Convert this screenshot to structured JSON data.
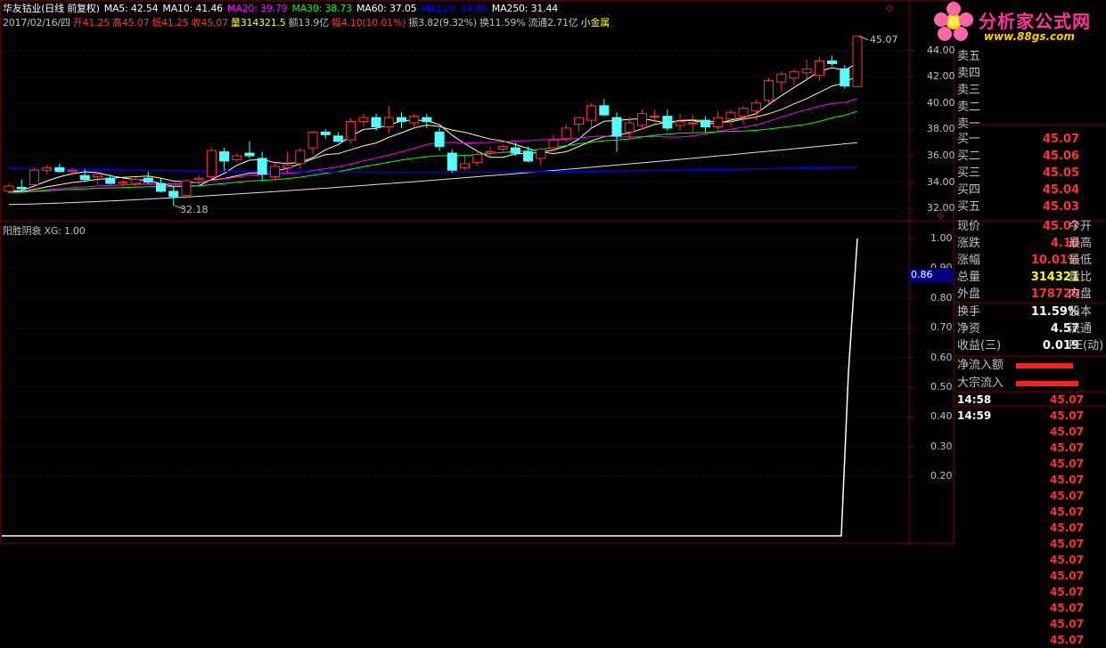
{
  "header": {
    "stock": "华友钴业(日线 前复权)",
    "ma": [
      {
        "label": "MA5: 42.54",
        "color": "#ffffff"
      },
      {
        "label": "MA10: 41.46",
        "color": "#ffffff"
      },
      {
        "label": "MA20: 39.79",
        "color": "#ff00ff"
      },
      {
        "label": "MA30: 38.73",
        "color": "#00ff00"
      },
      {
        "label": "MA60: 37.05",
        "color": "#ffffff"
      },
      {
        "label": "MA120: 34.88",
        "color": "#0000ff"
      },
      {
        "label": "MA250: 31.44",
        "color": "#ffffff"
      }
    ],
    "line2": [
      {
        "label": "2017/02/16/四",
        "color": "#c0c0c0"
      },
      {
        "label": "开41.25",
        "color": "#ff3232"
      },
      {
        "label": "高45.07",
        "color": "#ff3232"
      },
      {
        "label": "低41.25",
        "color": "#ff3232"
      },
      {
        "label": "收45.07",
        "color": "#ff3232"
      },
      {
        "label": "量314321.5",
        "color": "#ffff00"
      },
      {
        "label": "额13.9亿",
        "color": "#c0c0c0"
      },
      {
        "label": "幅4.10(10.01%)",
        "color": "#ff3232"
      },
      {
        "label": "振3.82(9.32%)",
        "color": "#c0c0c0"
      },
      {
        "label": "换11.59%",
        "color": "#c0c0c0"
      },
      {
        "label": "流通2.71亿",
        "color": "#c0c0c0"
      },
      {
        "label": "小金属",
        "color": "#ffff00"
      }
    ]
  },
  "price_axis": [
    "44.00",
    "42.00",
    "40.00",
    "38.00",
    "36.00",
    "34.00",
    "32.00"
  ],
  "price_marks": {
    "high": "45.07",
    "low": "32.18"
  },
  "indicator": {
    "title": "阳胜阴衰 XG: 1.00",
    "highlight": "0.86"
  },
  "indicator_axis": [
    "1.00",
    "0.90",
    "0.80",
    "0.70",
    "0.60",
    "0.50",
    "0.40",
    "0.30",
    "0.20"
  ],
  "logo": {
    "brand": "分析家公式网",
    "url": "www.88gs.com"
  },
  "orderbook": {
    "sell": [
      {
        "label": "卖五",
        "price": ""
      },
      {
        "label": "卖四",
        "price": ""
      },
      {
        "label": "卖三",
        "price": ""
      },
      {
        "label": "卖二",
        "price": ""
      },
      {
        "label": "卖一",
        "price": ""
      }
    ],
    "buy": [
      {
        "label": "买一",
        "price": "45.07"
      },
      {
        "label": "买二",
        "price": "45.06"
      },
      {
        "label": "买三",
        "price": "45.05"
      },
      {
        "label": "买四",
        "price": "45.04"
      },
      {
        "label": "买五",
        "price": "45.03"
      }
    ]
  },
  "quote": [
    {
      "label": "现价",
      "value": "45.07",
      "color": "#ff3232",
      "label2": "今开"
    },
    {
      "label": "涨跌",
      "value": "4.10",
      "color": "#ff3232",
      "label2": "最高"
    },
    {
      "label": "涨幅",
      "value": "10.01%",
      "color": "#ff3232",
      "label2": "最低"
    },
    {
      "label": "总量",
      "value": "314321",
      "color": "#ffff00",
      "label2": "量比"
    },
    {
      "label": "外盘",
      "value": "178720",
      "color": "#ff3232",
      "label2": "内盘"
    }
  ],
  "finance": [
    {
      "label": "换手",
      "value": "11.59%",
      "label2": "股本"
    },
    {
      "label": "净资",
      "value": "4.57",
      "label2": "流通"
    },
    {
      "label": "收益(三)",
      "value": "0.019",
      "label2": "PE(动)"
    }
  ],
  "flows": [
    {
      "label": "净流入额"
    },
    {
      "label": "大宗流入"
    }
  ],
  "ticks": [
    {
      "time": "14:58",
      "price": "45.07"
    },
    {
      "time": "14:59",
      "price": "45.07"
    },
    {
      "time": "",
      "price": "45.07"
    },
    {
      "time": "",
      "price": "45.07"
    },
    {
      "time": "",
      "price": "45.07"
    },
    {
      "time": "",
      "price": "45.07"
    },
    {
      "time": "",
      "price": "45.07"
    },
    {
      "time": "",
      "price": "45.07"
    },
    {
      "time": "",
      "price": "45.07"
    },
    {
      "time": "",
      "price": "45.07"
    },
    {
      "time": "",
      "price": "45.07"
    },
    {
      "time": "",
      "price": "45.07"
    },
    {
      "time": "",
      "price": "45.07"
    },
    {
      "time": "",
      "price": "45.07"
    },
    {
      "time": "",
      "price": "45.07"
    },
    {
      "time": "",
      "price": "45.07"
    }
  ],
  "chart_data": {
    "type": "candlestick",
    "candles": [
      [
        33.3,
        33.9,
        33.1,
        33.7
      ],
      [
        33.6,
        34.2,
        33.3,
        33.5
      ],
      [
        33.8,
        35.1,
        33.6,
        34.9
      ],
      [
        34.9,
        35.3,
        34.6,
        35.1
      ],
      [
        35.1,
        35.4,
        34.7,
        34.8
      ],
      [
        34.8,
        35.1,
        34.5,
        34.9
      ],
      [
        34.5,
        35.0,
        34.0,
        34.2
      ],
      [
        34.4,
        34.8,
        33.8,
        34.6
      ],
      [
        34.3,
        34.6,
        33.8,
        33.9
      ],
      [
        33.9,
        34.2,
        33.5,
        34.0
      ],
      [
        33.9,
        34.4,
        33.6,
        34.2
      ],
      [
        34.3,
        34.8,
        33.9,
        34.0
      ],
      [
        33.9,
        34.3,
        33.2,
        33.3
      ],
      [
        33.3,
        33.6,
        32.2,
        32.9
      ],
      [
        33.0,
        34.2,
        32.8,
        34.1
      ],
      [
        34.2,
        34.5,
        33.8,
        34.3
      ],
      [
        34.4,
        36.6,
        34.2,
        36.4
      ],
      [
        36.3,
        36.6,
        34.9,
        35.6
      ],
      [
        35.7,
        36.2,
        35.5,
        36.0
      ],
      [
        36.2,
        37.1,
        35.8,
        36.0
      ],
      [
        35.8,
        36.3,
        34.1,
        34.6
      ],
      [
        34.4,
        35.4,
        34.1,
        35.2
      ],
      [
        35.1,
        36.3,
        34.6,
        35.3
      ],
      [
        35.4,
        36.6,
        35.0,
        36.4
      ],
      [
        36.6,
        37.9,
        36.1,
        37.8
      ],
      [
        37.8,
        38.0,
        37.3,
        37.6
      ],
      [
        37.5,
        37.8,
        37.0,
        37.1
      ],
      [
        37.2,
        38.9,
        36.9,
        38.6
      ],
      [
        38.6,
        39.2,
        38.2,
        38.9
      ],
      [
        38.9,
        39.2,
        37.9,
        38.2
      ],
      [
        38.2,
        39.8,
        37.7,
        38.9
      ],
      [
        38.9,
        39.3,
        38.1,
        38.6
      ],
      [
        38.5,
        39.2,
        38.2,
        39.0
      ],
      [
        38.9,
        39.2,
        38.1,
        38.6
      ],
      [
        37.8,
        38.1,
        36.4,
        36.7
      ],
      [
        36.2,
        36.5,
        34.7,
        34.9
      ],
      [
        35.1,
        36.1,
        34.9,
        35.4
      ],
      [
        35.5,
        36.4,
        35.2,
        36.1
      ],
      [
        36.2,
        36.7,
        35.9,
        36.3
      ],
      [
        36.5,
        36.9,
        36.2,
        36.7
      ],
      [
        36.6,
        37.0,
        36.0,
        36.2
      ],
      [
        36.3,
        36.7,
        35.5,
        35.6
      ],
      [
        35.8,
        36.6,
        35.3,
        36.5
      ],
      [
        36.6,
        37.6,
        36.3,
        37.2
      ],
      [
        37.3,
        38.4,
        37.0,
        38.1
      ],
      [
        38.4,
        39.0,
        37.8,
        38.9
      ],
      [
        38.7,
        40.0,
        38.2,
        39.8
      ],
      [
        39.8,
        40.3,
        39.0,
        39.1
      ],
      [
        38.9,
        39.3,
        36.3,
        37.5
      ],
      [
        37.8,
        38.9,
        37.2,
        38.5
      ],
      [
        38.3,
        39.5,
        38.0,
        39.2
      ],
      [
        39.0,
        39.5,
        38.5,
        39.0
      ],
      [
        39.0,
        39.5,
        37.9,
        38.1
      ],
      [
        38.3,
        39.2,
        37.9,
        38.6
      ],
      [
        38.5,
        39.1,
        37.8,
        38.5
      ],
      [
        38.7,
        39.0,
        37.8,
        38.2
      ],
      [
        38.2,
        39.4,
        37.9,
        38.9
      ],
      [
        38.8,
        39.5,
        38.2,
        39.3
      ],
      [
        39.0,
        39.8,
        38.4,
        39.6
      ],
      [
        39.4,
        40.3,
        38.7,
        40.0
      ],
      [
        40.2,
        41.9,
        39.9,
        41.7
      ],
      [
        41.6,
        42.4,
        40.9,
        42.2
      ],
      [
        41.9,
        42.6,
        41.4,
        42.4
      ],
      [
        42.3,
        43.3,
        41.7,
        42.6
      ],
      [
        42.1,
        43.5,
        41.7,
        43.2
      ],
      [
        43.2,
        43.6,
        42.8,
        43.0
      ],
      [
        42.6,
        42.9,
        41.1,
        41.3
      ],
      [
        41.25,
        45.07,
        41.25,
        45.07
      ]
    ]
  }
}
